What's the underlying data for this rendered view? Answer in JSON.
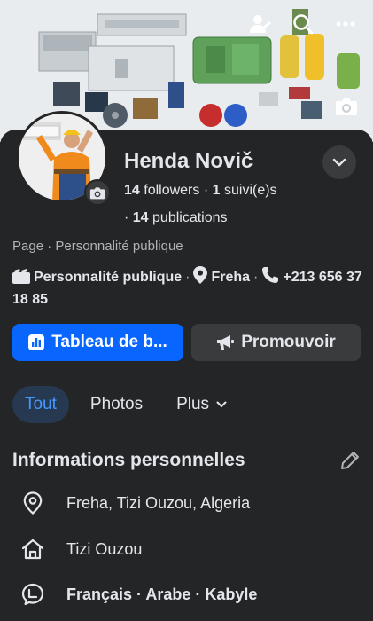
{
  "header": {
    "icons": [
      "profile-switch-icon",
      "search-icon",
      "more-icon"
    ]
  },
  "profile": {
    "name": "Henda Novič",
    "followers_count": "14",
    "followers_label": "followers",
    "following_count": "1",
    "following_label": "suivi(e)s",
    "publications_count": "14",
    "publications_label": "publications",
    "category_line": "Page · Personnalité publique"
  },
  "contact": {
    "category": "Personnalité publique",
    "location": "Freha",
    "phone": "+213 656 37 18 85"
  },
  "buttons": {
    "dashboard_label": "Tableau de b...",
    "promote_label": "Promouvoir"
  },
  "tabs": [
    {
      "label": "Tout",
      "active": true
    },
    {
      "label": "Photos",
      "active": false
    },
    {
      "label": "Plus",
      "active": false
    }
  ],
  "about": {
    "title": "Informations personnelles",
    "rows": [
      {
        "icon": "location-pin-icon",
        "text": "Freha, Tizi Ouzou, Algeria"
      },
      {
        "icon": "home-icon",
        "text": "Tizi Ouzou"
      },
      {
        "icon": "language-icon",
        "text": "Français · Arabe · Kabyle"
      }
    ]
  },
  "colors": {
    "background": "#242526",
    "primary_button": "#0866ff",
    "active_tab_bg": "#263951",
    "active_tab_text": "#4599ff"
  }
}
